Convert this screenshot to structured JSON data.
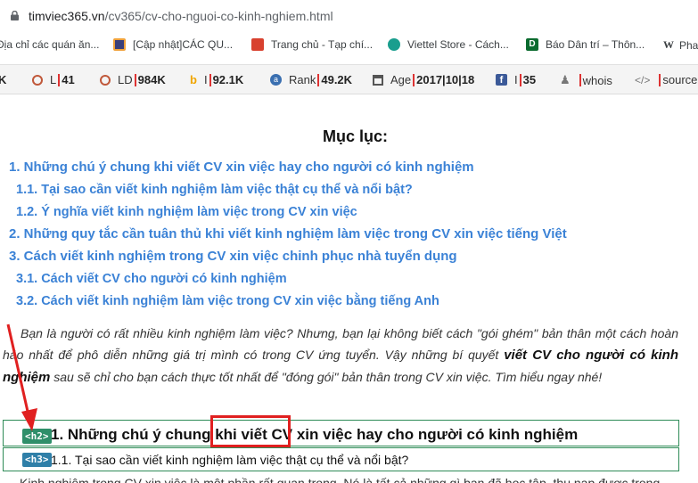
{
  "address_bar": {
    "host": "timviec365.vn",
    "path": "/cv365/cv-cho-nguoi-co-kinh-nghiem.html"
  },
  "bookmarks": [
    {
      "label": "Địa chỉ các quán ăn...",
      "icon": "page-icon",
      "color": "#ffffff"
    },
    {
      "label": "[Cập nhật]CÁC QU...",
      "icon": "site-favicon",
      "color": "#f0a23b"
    },
    {
      "label": "Trang chủ - Tạp chí...",
      "icon": "flag-icon",
      "color": "#d8412f"
    },
    {
      "label": "Viettel Store - Cách...",
      "icon": "viettel-icon",
      "color": "#1a9e8e"
    },
    {
      "label": "Báo Dân trí – Thôn...",
      "icon": "dantri-icon",
      "color": "#0b6b2f"
    },
    {
      "label": "Pha",
      "icon": "wikipedia-icon",
      "color": "#222222"
    }
  ],
  "seo_toolbar": [
    {
      "label": "K",
      "value": ""
    },
    {
      "label": "L",
      "value": "41"
    },
    {
      "label": "LD",
      "value": "984K"
    },
    {
      "label": "I",
      "value": "92.1K"
    },
    {
      "label": "Rank",
      "value": "49.2K"
    },
    {
      "label": "Age",
      "value": "2017|10|18"
    },
    {
      "label": "I",
      "value": "35"
    },
    {
      "label": "",
      "value": "whois"
    },
    {
      "label": "",
      "value": "source"
    }
  ],
  "toc": {
    "title": "Mục lục:",
    "items": [
      "1. Những chú ý chung khi viết CV xin việc hay cho người có kinh nghiệm",
      "1.1. Tại sao cần viết kinh nghiệm làm việc thật cụ thể và nổi bật?",
      "1.2. Ý nghĩa viết kinh nghiệm làm việc trong CV xin việc",
      "2. Những quy tắc cần tuân thủ khi viết kinh nghiệm làm việc trong CV xin việc tiếng Việt",
      "3. Cách viết kinh nghiệm trong CV xin việc chinh phục nhà tuyển dụng",
      "3.1. Cách viết CV cho người có kinh nghiệm",
      "3.2. Cách viết kinh nghiệm làm việc trong CV xin việc bằng tiếng Anh"
    ]
  },
  "intro": {
    "before": "Bạn là người có rất nhiều kinh nghiệm làm việc? Nhưng, bạn lại không biết cách \"gói ghém\" bản thân một cách hoàn hảo nhất để phô diễn những giá trị mình có trong CV ứng tuyển. Vậy những bí quyết ",
    "bold": "viết CV cho người có kinh nghiệm",
    "after": " sau sẽ chỉ cho bạn cách thực tốt nhất để \"đóng gói\" bản thân trong CV xin việc. Tìm hiểu ngay nhé!"
  },
  "heading_h2": {
    "tag": "<h2>",
    "text": "1. Những chú ý chung khi viết CV xin việc hay cho người có kinh nghiệm"
  },
  "heading_h3": {
    "tag": "<h3>",
    "text": "1.1. Tại sao cần viết kinh nghiệm làm việc thật cụ thể và nổi bật?"
  },
  "next_paragraph": "Kinh nghiệm trong CV xin việc là một phần rất quan trọng. Nó là tất cả những gì bạn đã học tập, thu nạp được trong",
  "colors": {
    "link": "#3b82d6",
    "highlight_box": "#e02020",
    "h2_tag": "#2f8f6a",
    "h3_tag": "#2f7fa8",
    "arrow": "#e02020"
  }
}
